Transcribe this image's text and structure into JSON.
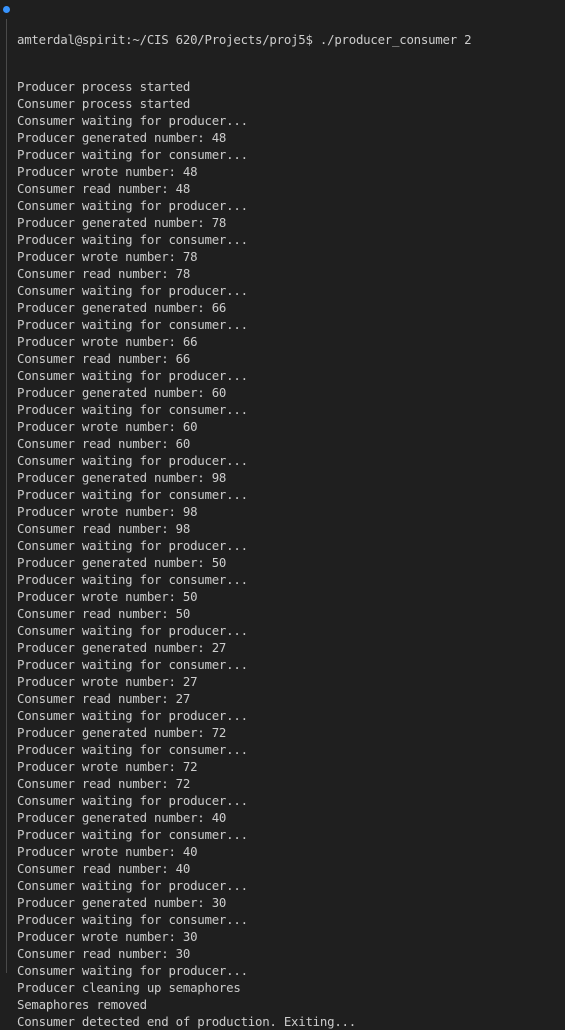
{
  "terminal": {
    "prompt": "amterdal@spirit:~/CIS 620/Projects/proj5$ ./producer_consumer 2",
    "output": [
      "Producer process started",
      "Consumer process started",
      "Consumer waiting for producer...",
      "Producer generated number: 48",
      "Producer waiting for consumer...",
      "Producer wrote number: 48",
      "Consumer read number: 48",
      "Consumer waiting for producer...",
      "Producer generated number: 78",
      "Producer waiting for consumer...",
      "Producer wrote number: 78",
      "Consumer read number: 78",
      "Consumer waiting for producer...",
      "Producer generated number: 66",
      "Producer waiting for consumer...",
      "Producer wrote number: 66",
      "Consumer read number: 66",
      "Consumer waiting for producer...",
      "Producer generated number: 60",
      "Producer waiting for consumer...",
      "Producer wrote number: 60",
      "Consumer read number: 60",
      "Consumer waiting for producer...",
      "Producer generated number: 98",
      "Producer waiting for consumer...",
      "Producer wrote number: 98",
      "Consumer read number: 98",
      "Consumer waiting for producer...",
      "Producer generated number: 50",
      "Producer waiting for consumer...",
      "Producer wrote number: 50",
      "Consumer read number: 50",
      "Consumer waiting for producer...",
      "Producer generated number: 27",
      "Producer waiting for consumer...",
      "Producer wrote number: 27",
      "Consumer read number: 27",
      "Consumer waiting for producer...",
      "Producer generated number: 72",
      "Producer waiting for consumer...",
      "Producer wrote number: 72",
      "Consumer read number: 72",
      "Consumer waiting for producer...",
      "Producer generated number: 40",
      "Producer waiting for consumer...",
      "Producer wrote number: 40",
      "Consumer read number: 40",
      "Consumer waiting for producer...",
      "Producer generated number: 30",
      "Producer waiting for consumer...",
      "Producer wrote number: 30",
      "Consumer read number: 30",
      "Consumer waiting for producer...",
      "Producer cleaning up semaphores",
      "Semaphores removed",
      "Consumer detected end of production. Exiting..."
    ]
  },
  "colors": {
    "background": "#1f1f1f",
    "text": "#cccccc",
    "status_dot": "#3794ff",
    "gutter": "#4a4a4a"
  },
  "icons": {
    "status": "command-status-dot-icon"
  }
}
